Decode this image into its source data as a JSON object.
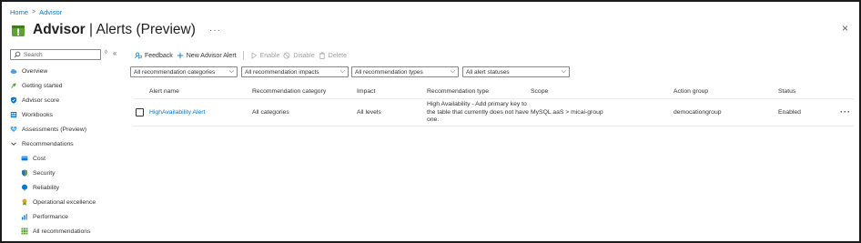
{
  "breadcrumb": {
    "home": "Home",
    "separator": ">",
    "current": "Advisor"
  },
  "header": {
    "title": "Advisor",
    "divider": " | ",
    "subtitle": "Alerts (Preview)",
    "more": "···",
    "close": "×"
  },
  "sidebar": {
    "search_placeholder": "Search",
    "search_side_glyph": "◊",
    "collapse_glyph": "«",
    "items": [
      {
        "label": "Overview",
        "icon": "cloud-icon"
      },
      {
        "label": "Getting started",
        "icon": "rocket-icon"
      },
      {
        "label": "Advisor score",
        "icon": "shield-check-icon"
      },
      {
        "label": "Workbooks",
        "icon": "workbook-icon"
      },
      {
        "label": "Assessments (Preview)",
        "icon": "assessment-icon"
      },
      {
        "label": "Recommendations",
        "icon": "chevron-down-icon"
      },
      {
        "label": "Cost",
        "icon": "cost-icon"
      },
      {
        "label": "Security",
        "icon": "security-icon"
      },
      {
        "label": "Reliability",
        "icon": "reliability-icon"
      },
      {
        "label": "Operational excellence",
        "icon": "operational-excellence-icon"
      },
      {
        "label": "Performance",
        "icon": "performance-icon"
      },
      {
        "label": "All recommendations",
        "icon": "grid-icon"
      }
    ]
  },
  "toolbar": {
    "feedback": "Feedback",
    "new_alert": "New Advisor Alert",
    "enable": "Enable",
    "disable": "Disable",
    "delete": "Delete"
  },
  "filters": {
    "categories": "All recommendation categories",
    "impacts": "All recommendation impacts",
    "types": "All recommendation types",
    "statuses": "All alert statuses"
  },
  "table": {
    "columns": [
      "Alert name",
      "Recommendation category",
      "Impact",
      "Recommendation type",
      "Scope",
      "Action group",
      "Status"
    ],
    "rows": [
      {
        "alert_name": "HighAvailability Alert",
        "category": "All categories",
        "impact": "All levels",
        "type": "High Availability - Add primary key to the table that currently does not have one.",
        "scope": "MySQL aaS > micai-group",
        "action_group": "democationgroup",
        "status": "Enabled",
        "more": "···"
      }
    ]
  },
  "colors": {
    "accent": "#0078d4",
    "advisor_green": "#5ea331",
    "text": "#323130",
    "disabled": "#a19f9d"
  }
}
